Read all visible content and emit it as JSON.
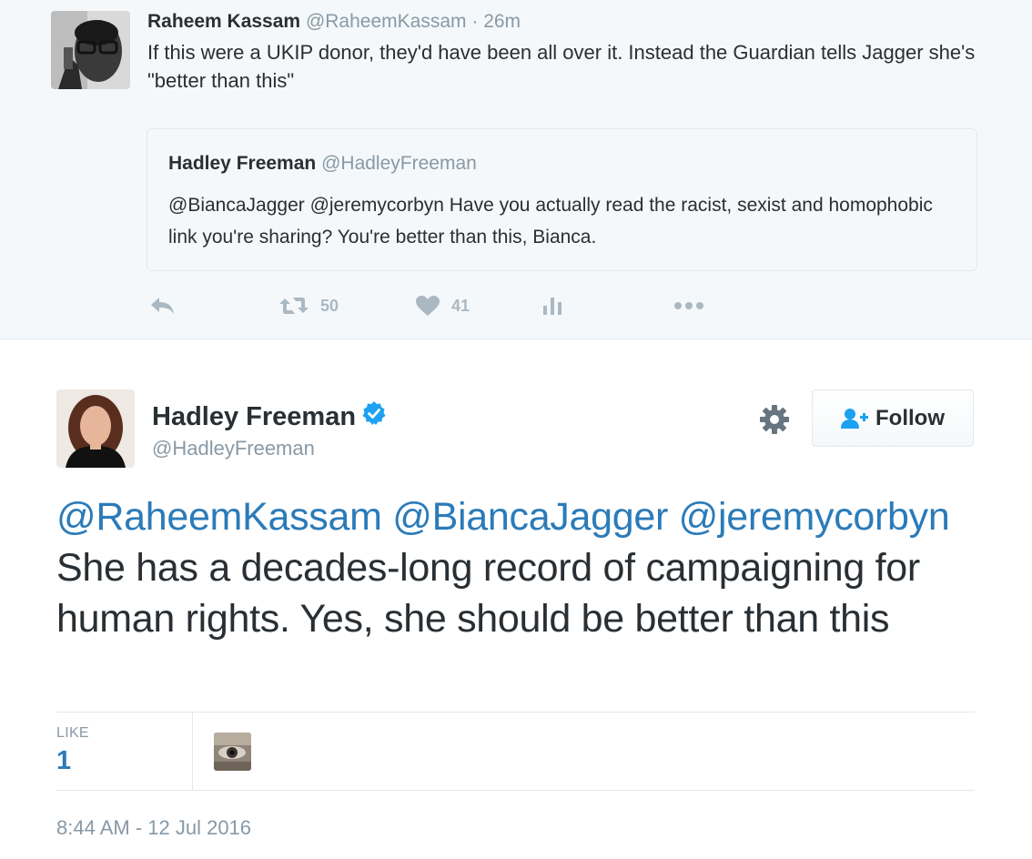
{
  "parent_tweet": {
    "author_name": "Raheem Kassam",
    "author_handle": "@RaheemKassam",
    "separator": "·",
    "time": "26m",
    "text": "If this were a UKIP donor, they'd have been all over it. Instead the Guardian tells Jagger she's \"better than this\"",
    "quoted": {
      "author_name": "Hadley Freeman",
      "author_handle": "@HadleyFreeman",
      "text": "@BiancaJagger @jeremycorbyn Have you actually read the racist, sexist and homophobic link you're sharing? You're better than this, Bianca."
    },
    "actions": {
      "reply_icon": "reply-icon",
      "retweet_icon": "retweet-icon",
      "retweet_count": "50",
      "like_icon": "heart-icon",
      "like_count": "41",
      "analytics_icon": "analytics-icon",
      "more_icon": "more-icon"
    }
  },
  "main_tweet": {
    "author_name": "Hadley Freeman",
    "author_handle": "@HadleyFreeman",
    "verified_icon": "verified-badge-icon",
    "settings_icon": "gear-icon",
    "follow_label": "Follow",
    "follow_icon": "add-user-icon",
    "mentions": [
      "@RaheemKassam",
      "@BiancaJagger",
      "@jeremycorbyn"
    ],
    "body_text": "She has a decades-long record of campaigning for human rights. Yes, she should be better than this",
    "likes_label": "LIKE",
    "likes_count": "1",
    "timestamp": "8:44 AM - 12 Jul 2016"
  },
  "colors": {
    "link": "#2b7bb9",
    "muted": "#8899a6",
    "text": "#292f33",
    "parent_background": "#f5f8fa",
    "border": "#e1e8ed",
    "verified": "#1da1f2",
    "action_icon": "#aab8c2"
  }
}
